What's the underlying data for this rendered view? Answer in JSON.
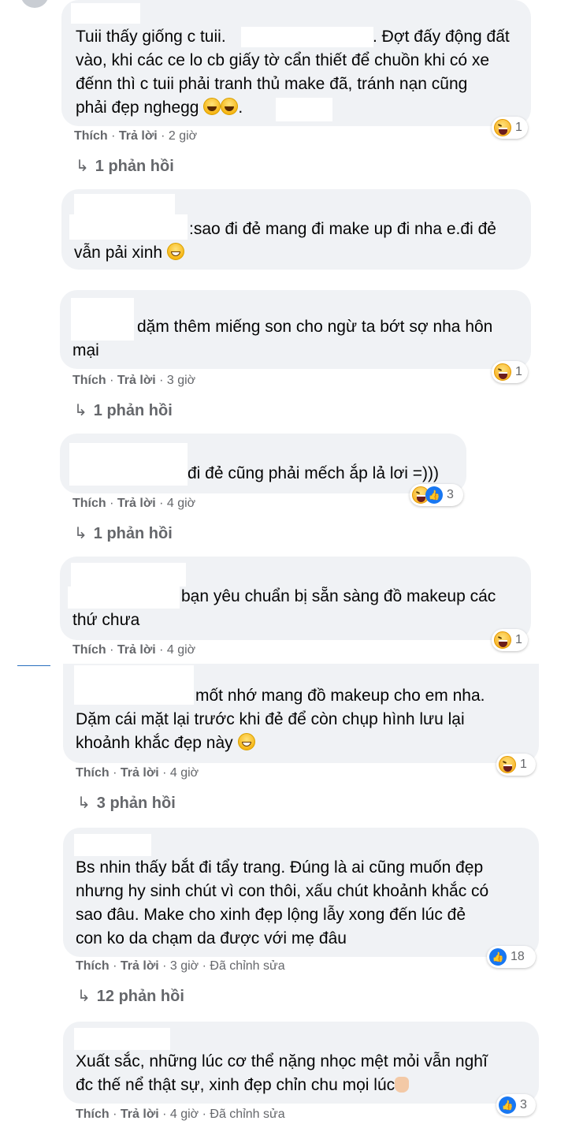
{
  "actions": {
    "like": "Thích",
    "reply": "Trả lời",
    "edited": "Đã chỉnh sửa",
    "sep": "·"
  },
  "comments": [
    {
      "text_lines": [
        "Tuii thấy giống c tuii.",
        ". Đợt đấy động đất",
        "vào, khi các ce lo cb giấy tờ cẩn thiết để chuồn khi có xe",
        "đếnn thì c tuii phải tranh thủ make đã, tránh nạn cũng",
        "phải đẹp nghegg"
      ],
      "time": "2 giờ",
      "reaction_count": "1",
      "reaction_type": "haha",
      "replies": "1 phản hồi"
    },
    {
      "text_lines": [
        ":sao đi đẻ mang đi make up đi nha e.đi đẻ",
        "vẫn pải xinh"
      ]
    },
    {
      "text_lines": [
        "dặm thêm miếng son cho ngừ ta bớt sợ nha hôn",
        "mại"
      ],
      "time": "3 giờ",
      "reaction_count": "1",
      "reaction_type": "haha",
      "replies": "1 phản hồi"
    },
    {
      "text_lines": [
        "đi đẻ cũng phải mếch ắp lả lơi =)))"
      ],
      "time": "4 giờ",
      "reaction_count": "3",
      "reaction_type": "haha+like",
      "replies": "1 phản hồi"
    },
    {
      "text_lines": [
        "bạn yêu chuẩn bị sẵn sàng đồ makeup các",
        "thứ chưa"
      ],
      "time": "4 giờ",
      "reaction_count": "1",
      "reaction_type": "haha"
    },
    {
      "text_lines": [
        "mốt nhớ mang đồ makeup cho em nha.",
        "Dặm cái mặt lại trước khi đẻ để còn chụp hình lưu lại",
        "khoảnh khắc đẹp này"
      ],
      "time": "4 giờ",
      "reaction_count": "1",
      "reaction_type": "haha",
      "replies": "3 phản hồi"
    },
    {
      "text_lines": [
        "Bs nhin thấy bắt đi tẩy trang. Đúng là ai cũng muốn đẹp",
        "nhưng hy sinh chút vì con thôi, xấu chút khoảnh khắc có",
        "sao đâu. Make cho xinh đẹp lộng lẫy xong đến lúc đẻ",
        "con ko da chạm da được với mẹ đâu"
      ],
      "time": "3 giờ",
      "edited": true,
      "reaction_count": "18",
      "reaction_type": "like",
      "replies": "12 phản hồi"
    },
    {
      "text_lines": [
        "Xuất sắc, những lúc cơ thể nặng nhọc mệt mỏi vẫn nghĩ",
        "đc thế nể thật sự, xinh đẹp chỉn chu mọi lúc"
      ],
      "time": "4 giờ",
      "edited": true,
      "reaction_count": "3",
      "reaction_type": "like"
    }
  ]
}
